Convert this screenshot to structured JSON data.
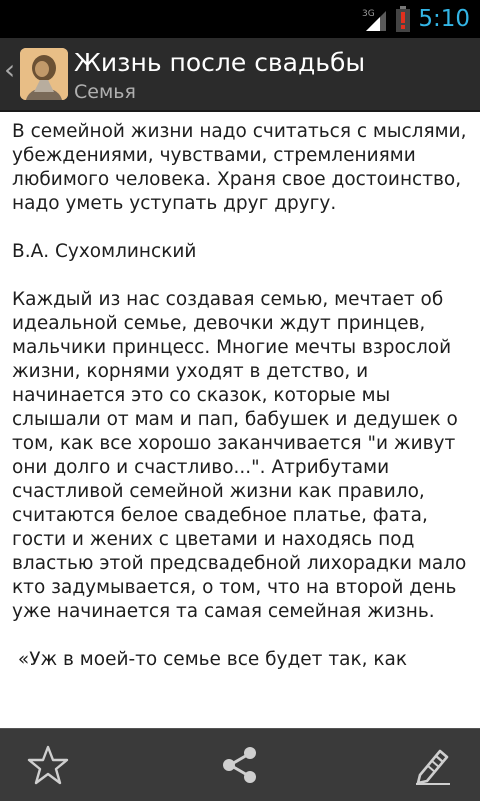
{
  "status_bar": {
    "network": "3G",
    "time": "5:10"
  },
  "action_bar": {
    "title": "Жизнь после свадьбы",
    "subtitle": "Семья",
    "icon": "portrait-app-icon"
  },
  "article": {
    "paragraphs": [
      "В семейной жизни надо считаться с мыслями, убеждениями, чувствами, стремлениями любимого человека. Храня свое достоинство, надо уметь уступать друг другу.",
      "В.А. Сухомлинский",
      "Каждый из нас создавая семью, мечтает об идеальной семье, девочки ждут принцев, мальчики принцесс. Многие мечты взрослой жизни, корнями уходят в детство, и начинается это со сказок, которые мы слышали от мам и пап, бабушек и дедушек о том, как все хорошо заканчивается \"и живут они долго и счастливо...\". Атрибутами счастливой семейной жизни как правило, считаются белое свадебное платье, фата, гости и жених с цветами и находясь под властью этой предсвадебной лихорадки мало кто задумывается, о том, что на второй день уже начинается та самая семейная жизнь.",
      " «Уж в моей-то семье все будет так, как"
    ]
  },
  "bottom_bar": {
    "icons": [
      "star-outline-icon",
      "share-icon",
      "edit-pencil-icon"
    ]
  }
}
